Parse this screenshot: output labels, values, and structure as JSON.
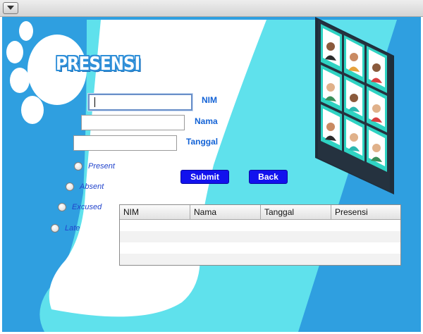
{
  "window": {
    "menu_icon": "chevron-down-icon"
  },
  "logo": {
    "text": "PRESENSI"
  },
  "form": {
    "nim_label": "NIM",
    "nama_label": "Nama",
    "tanggal_label": "Tanggal",
    "nim_value": "",
    "nama_value": "",
    "tanggal_value": ""
  },
  "radios": [
    {
      "label": "Present"
    },
    {
      "label": "Absent"
    },
    {
      "label": "Excused"
    },
    {
      "label": "Late"
    }
  ],
  "buttons": {
    "submit": "Submit",
    "back": "Back"
  },
  "table": {
    "columns": [
      "NIM",
      "Nama",
      "Tanggal",
      "Presensi"
    ],
    "rows": []
  },
  "colors": {
    "accent": "#1212ee",
    "background": "#2f9fe0",
    "panel": "#5fe1ec"
  }
}
